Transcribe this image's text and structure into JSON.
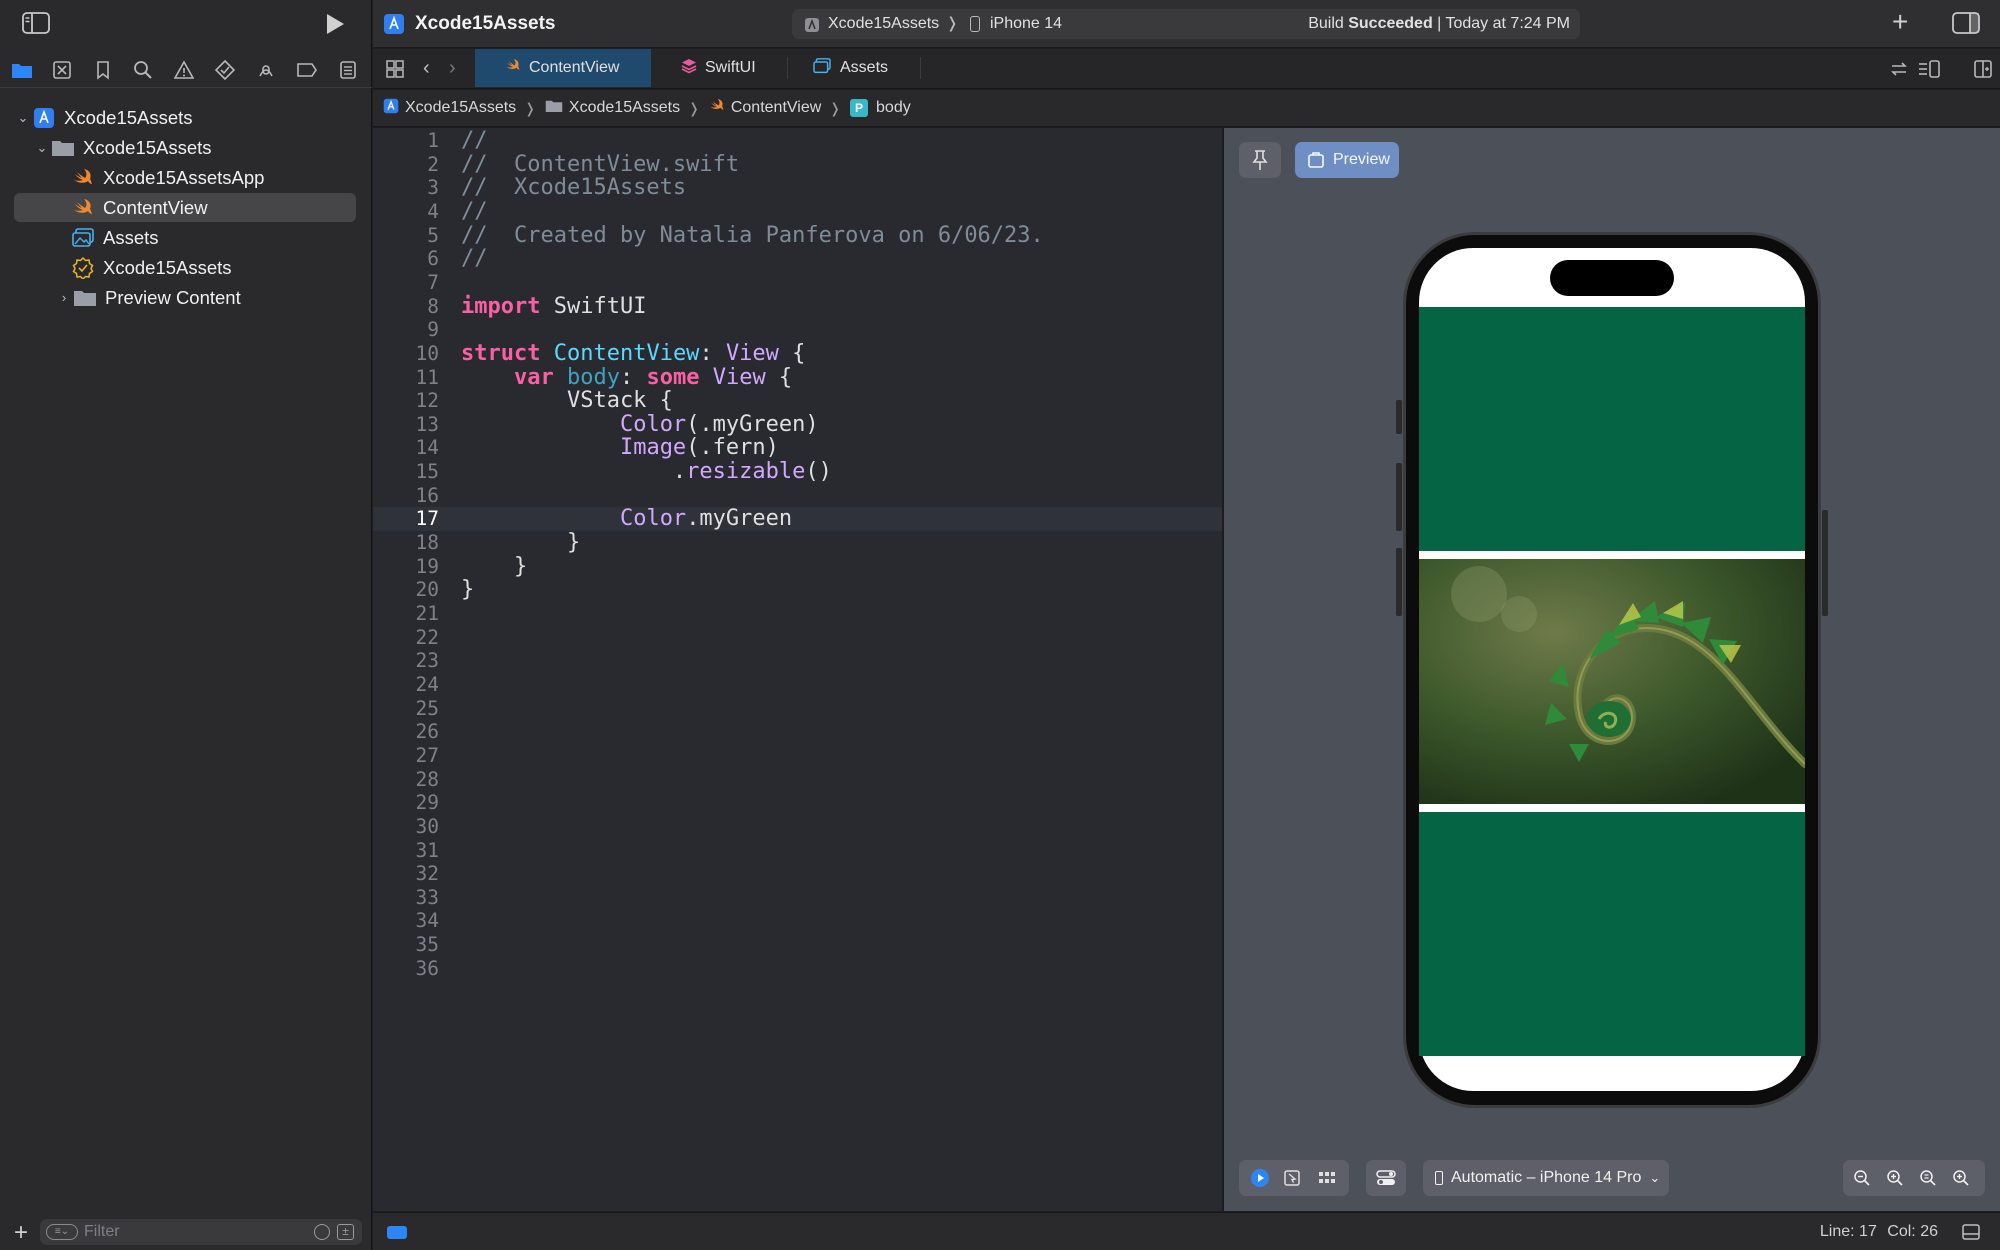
{
  "window": {
    "project_name": "Xcode15Assets",
    "scheme": "Xcode15Assets",
    "destination": "iPhone 14",
    "build_status_prefix": "Build",
    "build_status_result": "Succeeded",
    "build_status_time": "| Today at 7:24 PM"
  },
  "tabs": [
    {
      "label": "ContentView",
      "icon": "swift-icon",
      "active": true
    },
    {
      "label": "SwiftUI",
      "icon": "framework-stack-icon",
      "active": false
    },
    {
      "label": "Assets",
      "icon": "asset-catalog-icon",
      "active": false
    }
  ],
  "breadcrumb": [
    "Xcode15Assets",
    "Xcode15Assets",
    "ContentView",
    "body"
  ],
  "breadcrumb_badge": "P",
  "navigator": {
    "items": [
      {
        "label": "Xcode15Assets",
        "icon": "project-icon",
        "indent": 0,
        "disclosure": "open"
      },
      {
        "label": "Xcode15Assets",
        "icon": "folder-icon",
        "indent": 1,
        "disclosure": "open"
      },
      {
        "label": "Xcode15AssetsApp",
        "icon": "swift-icon",
        "indent": 2,
        "disclosure": ""
      },
      {
        "label": "ContentView",
        "icon": "swift-icon",
        "indent": 2,
        "disclosure": "",
        "selected": true
      },
      {
        "label": "Assets",
        "icon": "asset-catalog-icon",
        "indent": 2,
        "disclosure": ""
      },
      {
        "label": "Xcode15Assets",
        "icon": "entitlements-icon",
        "indent": 2,
        "disclosure": ""
      },
      {
        "label": "Preview Content",
        "icon": "folder-icon",
        "indent": 2,
        "disclosure": "closed"
      }
    ],
    "filter_placeholder": "Filter"
  },
  "code": {
    "current_line": 17,
    "line_count": 36,
    "lines": [
      [
        [
          "c",
          "//"
        ]
      ],
      [
        [
          "c",
          "//  ContentView.swift"
        ]
      ],
      [
        [
          "c",
          "//  Xcode15Assets"
        ]
      ],
      [
        [
          "c",
          "//"
        ]
      ],
      [
        [
          "c",
          "//  Created by Natalia Panferova on 6/06/23."
        ]
      ],
      [
        [
          "c",
          "//"
        ]
      ],
      [],
      [
        [
          "k",
          "import"
        ],
        [
          "p",
          " SwiftUI"
        ]
      ],
      [],
      [
        [
          "k",
          "struct"
        ],
        [
          "p",
          " "
        ],
        [
          "t",
          "ContentView"
        ],
        [
          "p",
          ": "
        ],
        [
          "s",
          "View"
        ],
        [
          "p",
          " {"
        ]
      ],
      [
        [
          "p",
          "    "
        ],
        [
          "k",
          "var"
        ],
        [
          "p",
          " "
        ],
        [
          "r",
          "body"
        ],
        [
          "p",
          ": "
        ],
        [
          "k",
          "some"
        ],
        [
          "p",
          " "
        ],
        [
          "s",
          "View"
        ],
        [
          "p",
          " {"
        ]
      ],
      [
        [
          "p",
          "        VStack {"
        ]
      ],
      [
        [
          "p",
          "            "
        ],
        [
          "s",
          "Color"
        ],
        [
          "p",
          "(.myGreen)"
        ]
      ],
      [
        [
          "p",
          "            "
        ],
        [
          "s",
          "Image"
        ],
        [
          "p",
          "(.fern)"
        ]
      ],
      [
        [
          "p",
          "                ."
        ],
        [
          "s",
          "resizable"
        ],
        [
          "p",
          "()"
        ]
      ],
      [],
      [
        [
          "p",
          "            "
        ],
        [
          "s",
          "Color"
        ],
        [
          "p",
          ".myGreen"
        ]
      ],
      [
        [
          "p",
          "        }"
        ]
      ],
      [
        [
          "p",
          "    }"
        ]
      ],
      [
        [
          "p",
          "}"
        ]
      ]
    ]
  },
  "canvas": {
    "preview_label": "Preview",
    "device_label": "Automatic – iPhone 14 Pro",
    "my_green": "#056443"
  },
  "statusbar": {
    "line_label": "Line: 17",
    "col_label": "Col: 26"
  }
}
